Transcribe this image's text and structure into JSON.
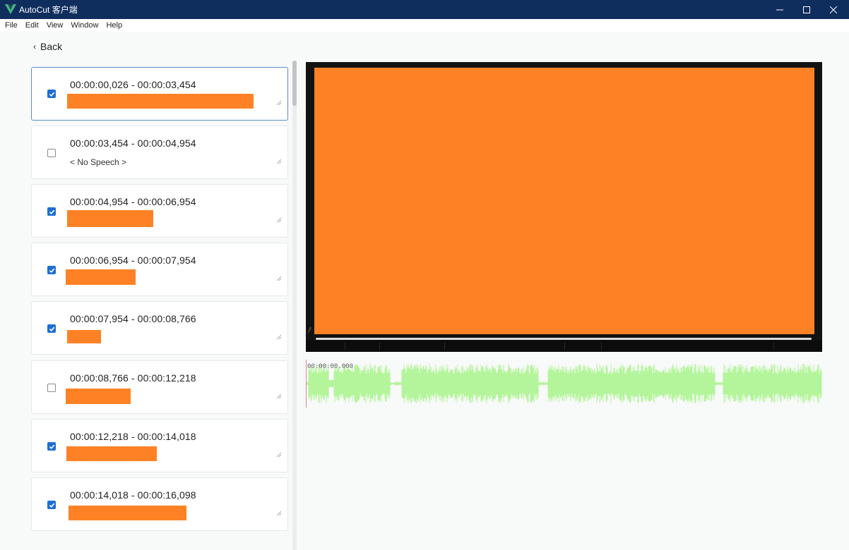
{
  "window": {
    "title": "AutoCut 客户端"
  },
  "menu": [
    "File",
    "Edit",
    "View",
    "Window",
    "Help"
  ],
  "back_label": "Back",
  "segments": [
    {
      "time": "00:00:00,026 - 00:00:03,454",
      "checked": true,
      "text": ""
    },
    {
      "time": "00:00:03,454 - 00:00:04,954",
      "checked": false,
      "text": "< No Speech >"
    },
    {
      "time": "00:00:04,954 - 00:00:06,954",
      "checked": true,
      "text": ""
    },
    {
      "time": "00:00:06,954 - 00:00:07,954",
      "checked": true,
      "text": ""
    },
    {
      "time": "00:00:07,954 - 00:00:08,766",
      "checked": true,
      "text": ""
    },
    {
      "time": "00:00:08,766 - 00:00:12,218",
      "checked": false,
      "text": ""
    },
    {
      "time": "00:00:12,218 - 00:00:14,018",
      "checked": true,
      "text": ""
    },
    {
      "time": "00:00:14,018 - 00:00:16,098",
      "checked": true,
      "text": ""
    }
  ],
  "waveform": {
    "time_label": "00:00:00.000",
    "color": "#b4f59b"
  },
  "colors": {
    "titlebar": "#0f2e5e",
    "redaction": "#fe8225",
    "checkbox": "#1e6ed6",
    "selected_border": "#5b8ec8"
  }
}
